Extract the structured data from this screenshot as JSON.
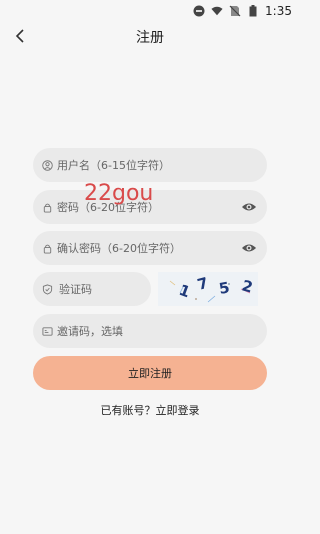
{
  "status_bar": {
    "time": "1:35"
  },
  "header": {
    "title": "注册"
  },
  "form": {
    "username_placeholder": "用户名（6-15位字符）",
    "password_placeholder": "密码（6-20位字符）",
    "confirm_placeholder": "确认密码（6-20位字符）",
    "captcha_placeholder": "验证码",
    "invite_placeholder": "邀请码，选填",
    "captcha_text": "1752",
    "submit_label": "立即注册",
    "login_prompt": "已有账号？立即登录"
  },
  "watermark": "22gou",
  "colors": {
    "accent": "#f5b292",
    "field_bg": "#eaeaea",
    "background": "#f6f6f6"
  }
}
